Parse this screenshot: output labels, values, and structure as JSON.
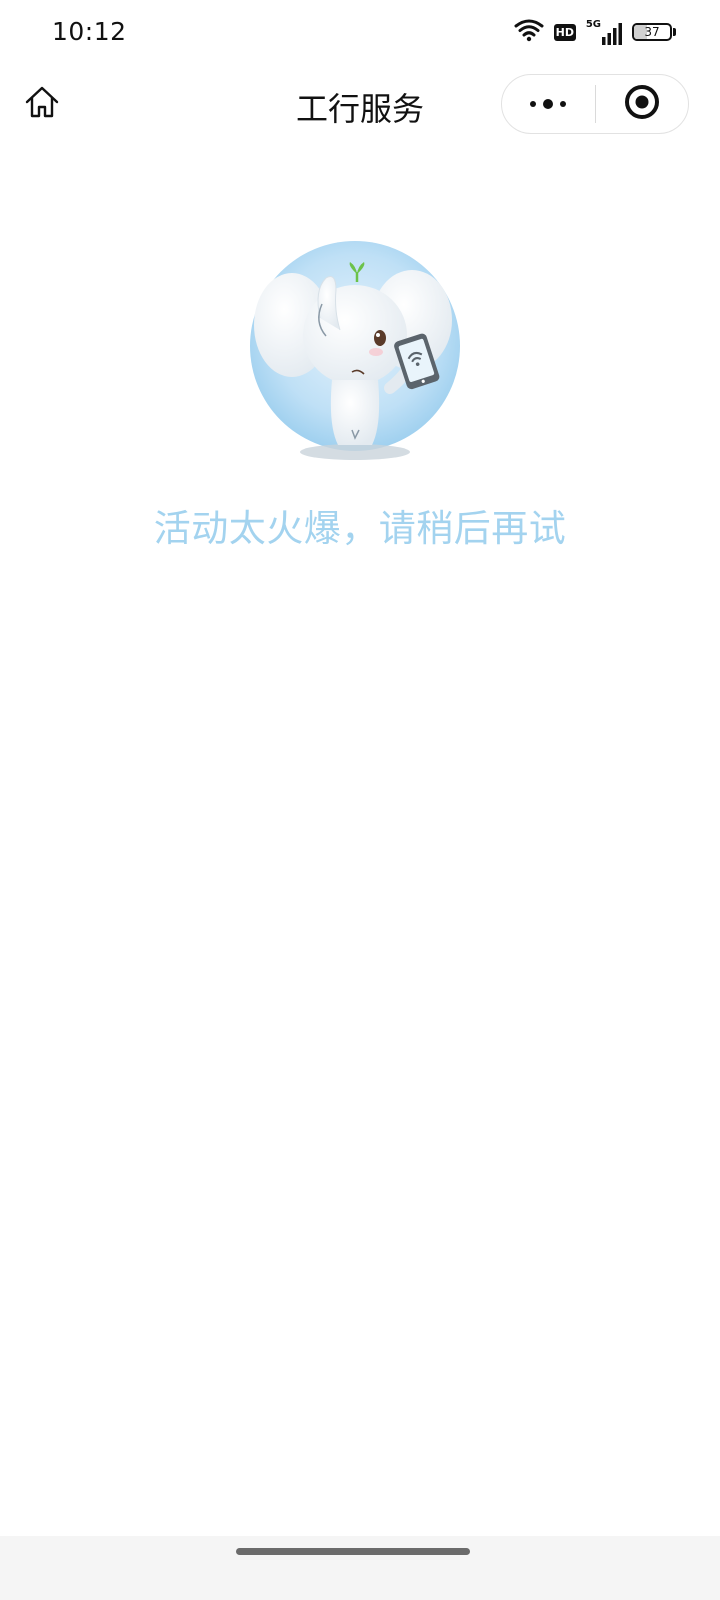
{
  "status_bar": {
    "time": "10:12",
    "network": "5G",
    "hd_label": "HD",
    "battery_level": "37",
    "battery_fraction": 0.37
  },
  "nav": {
    "title": "工行服务",
    "home_icon": "home-icon",
    "more_icon": "more-dots-icon",
    "close_icon": "target-close-icon"
  },
  "main": {
    "mascot_icon": "elephant-mascot-phone-icon",
    "message": "活动太火爆，请稍后再试"
  },
  "colors": {
    "message": "#a3d3ef",
    "mascot_background": "#a9d4f0",
    "sprout": "#6cc24a"
  }
}
